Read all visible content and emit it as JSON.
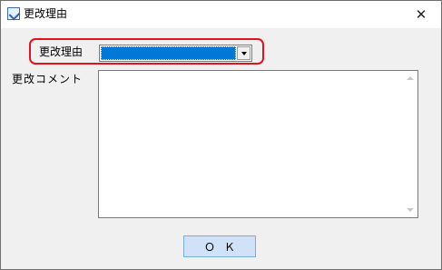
{
  "window": {
    "title": "更改理由",
    "close_glyph": "✕"
  },
  "form": {
    "reason_label": "更改理由",
    "reason_selected": "",
    "comment_label": "更改コメント",
    "comment_value": ""
  },
  "buttons": {
    "ok_label": "ＯＫ"
  },
  "colors": {
    "highlight": "#e0141e",
    "selection": "#0078d7",
    "ok_button_bg": "#cfe2f7"
  }
}
